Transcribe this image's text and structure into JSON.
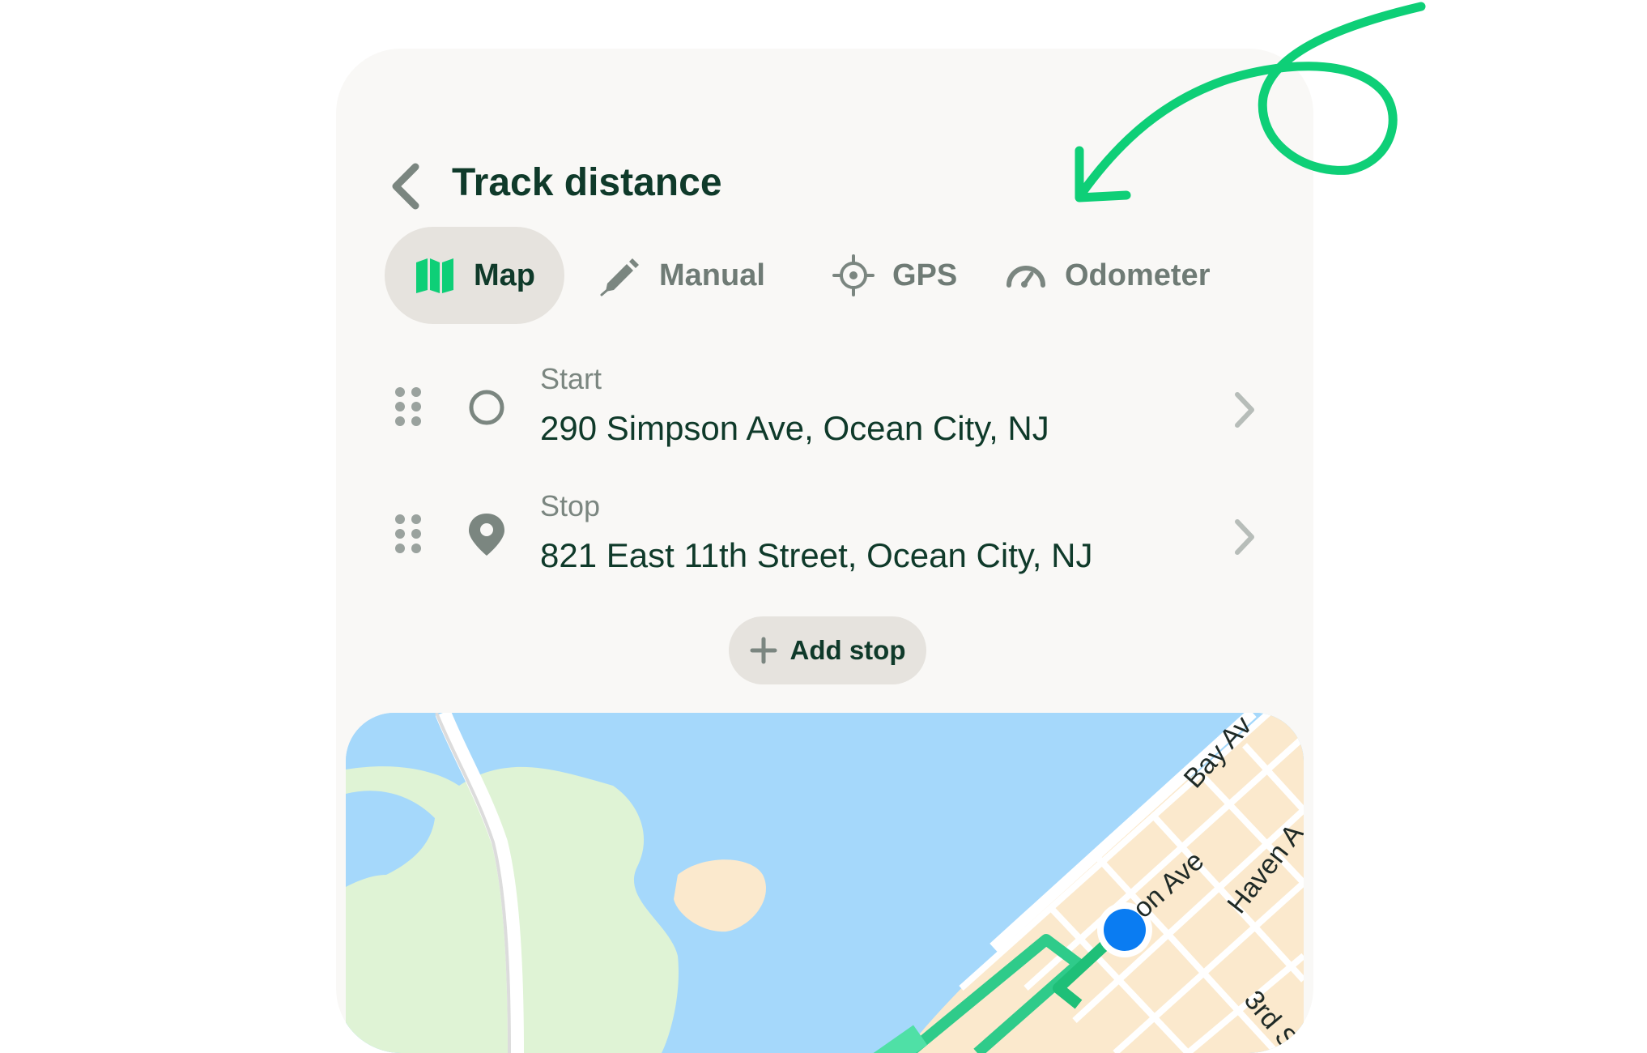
{
  "header": {
    "title": "Track distance"
  },
  "tabs": [
    {
      "label": "Map",
      "icon": "map-icon",
      "active": true
    },
    {
      "label": "Manual",
      "icon": "pencil-icon",
      "active": false
    },
    {
      "label": "GPS",
      "icon": "crosshair-icon",
      "active": false
    },
    {
      "label": "Odometer",
      "icon": "gauge-icon",
      "active": false
    }
  ],
  "route": {
    "start": {
      "label": "Start",
      "value": "290 Simpson Ave, Ocean City, NJ",
      "icon": "circle-icon"
    },
    "stop": {
      "label": "Stop",
      "value": "821 East 11th Street, Ocean City, NJ",
      "icon": "location-pin-icon"
    }
  },
  "add_stop": {
    "label": "Add stop",
    "icon": "plus-icon"
  },
  "map": {
    "street_labels": [
      "Bay Av",
      "on Ave",
      "Haven A",
      "3rd S"
    ]
  },
  "colors": {
    "brand_green": "#0ecf77",
    "dark_text": "#0f3a2a",
    "muted_text": "#7b8680",
    "active_tab_bg": "#e6e3de",
    "card_bg": "#f9f8f6",
    "water": "#a5d8fb",
    "park": "#dff3d5",
    "land": "#fbe9cd",
    "route": "#2fcb8a",
    "location_dot": "#0a7cf2"
  }
}
